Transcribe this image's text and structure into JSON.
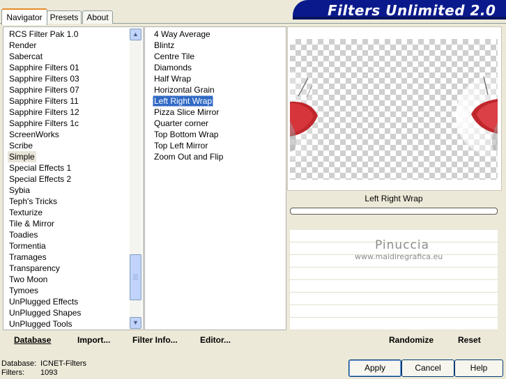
{
  "banner": {
    "title": "Filters Unlimited 2.0"
  },
  "tabs": [
    {
      "label": "Navigator",
      "active": true
    },
    {
      "label": "Presets",
      "active": false
    },
    {
      "label": "About",
      "active": false
    }
  ],
  "categories": [
    "RCS Filter Pak 1.0",
    "Render",
    "Sabercat",
    "Sapphire Filters 01",
    "Sapphire Filters 03",
    "Sapphire Filters 07",
    "Sapphire Filters 11",
    "Sapphire Filters 12",
    "Sapphire Filters 1c",
    "ScreenWorks",
    "Scribe",
    "Simple",
    "Special Effects 1",
    "Special Effects 2",
    "Sybia",
    "Teph's Tricks",
    "Texturize",
    "Tile & Mirror",
    "Toadies",
    "Tormentia",
    "Tramages",
    "Transparency",
    "Two Moon",
    "Tymoes",
    "UnPlugged Effects",
    "UnPlugged Shapes",
    "UnPlugged Tools"
  ],
  "selected_category": "Simple",
  "filters": [
    "4 Way Average",
    "Blintz",
    "Centre Tile",
    "Diamonds",
    "Half Wrap",
    "Horizontal Grain",
    "Left Right Wrap",
    "Pizza Slice Mirror",
    "Quarter corner",
    "Top Bottom Wrap",
    "Top Left Mirror",
    "Zoom Out and Flip"
  ],
  "selected_filter": "Left Right Wrap",
  "preview": {
    "filter_name": "Left Right Wrap"
  },
  "watermark": {
    "name": "Pinuccia",
    "site": "www.maidiregrafica.eu"
  },
  "toolbar": {
    "database": "Database",
    "import": "Import...",
    "filter_info": "Filter Info...",
    "editor": "Editor...",
    "randomize": "Randomize",
    "reset": "Reset"
  },
  "status": {
    "database_label": "Database:",
    "database_value": "ICNET-Filters",
    "filters_label": "Filters:",
    "filters_value": "1093"
  },
  "buttons": {
    "apply": "Apply",
    "cancel": "Cancel",
    "help": "Help"
  },
  "colors": {
    "banner": "#0a1a8c",
    "selection": "#316ac5",
    "window": "#ece9d8"
  }
}
